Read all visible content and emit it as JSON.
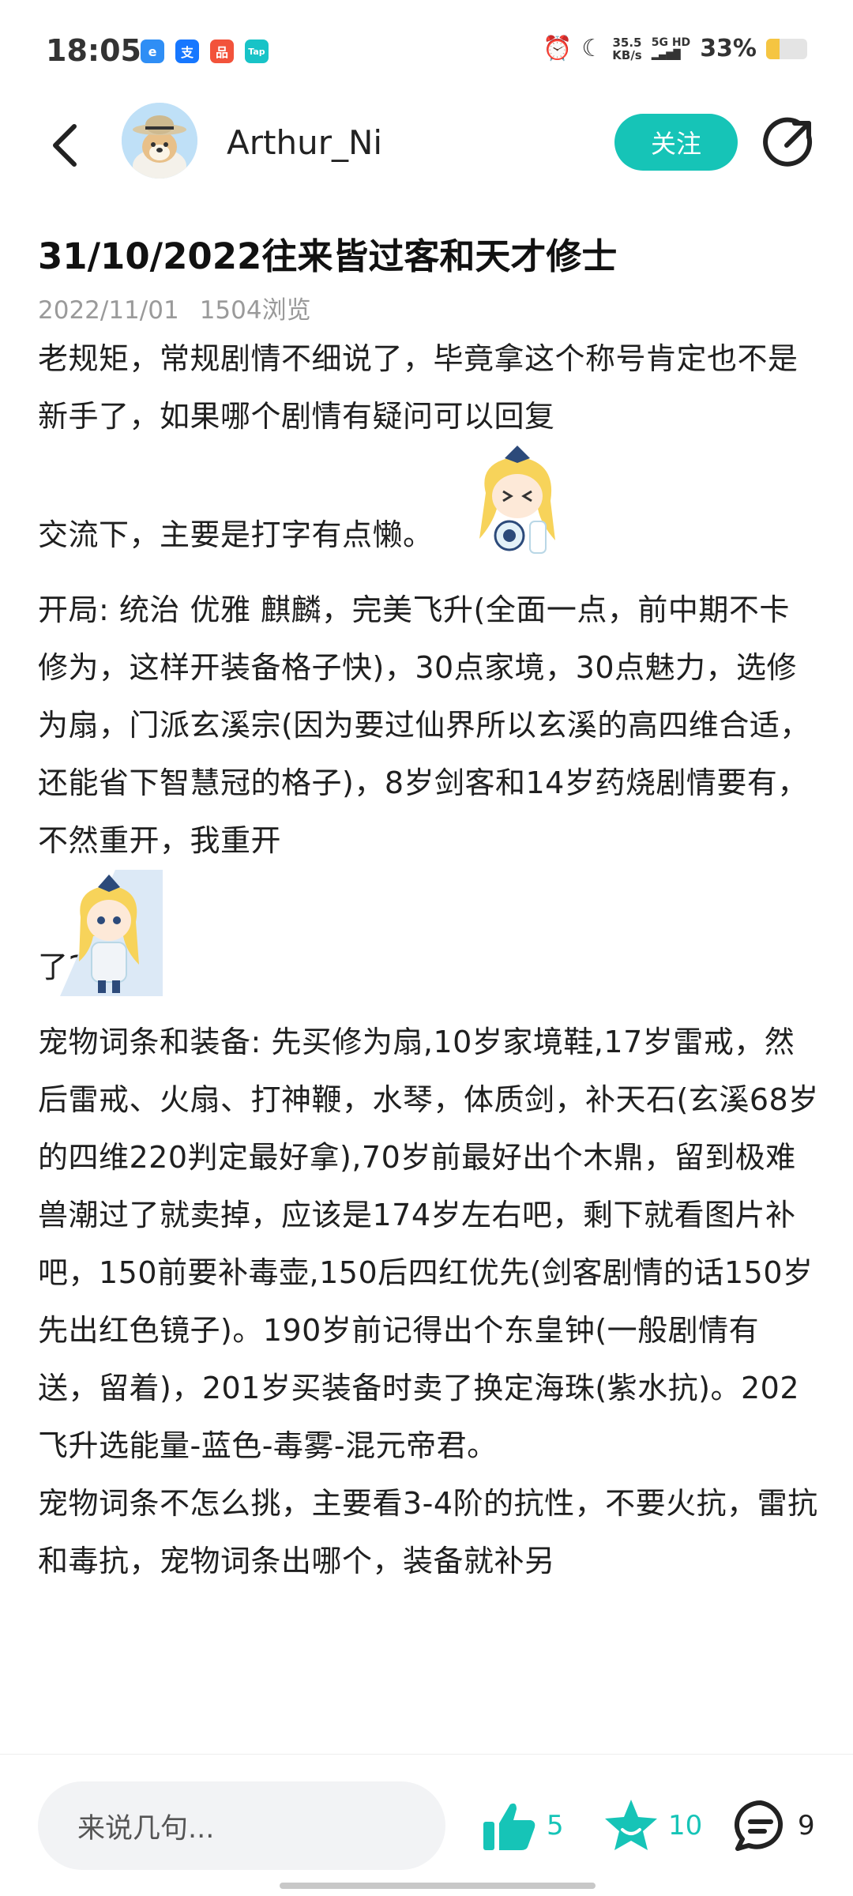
{
  "status_bar": {
    "time": "18:05",
    "apps": [
      {
        "label": "e",
        "color": "#2f8ef5",
        "icon": "app-icon-blue"
      },
      {
        "label": "支",
        "color": "#1677ff",
        "icon": "alipay-icon"
      },
      {
        "label": "品",
        "color": "#f2533b",
        "icon": "app-icon-red"
      },
      {
        "label": "Tap",
        "color": "#18c3c7",
        "icon": "taptap-icon"
      }
    ],
    "net_speed_value": "35.5",
    "net_speed_unit": "KB/s",
    "network_type": "5G HD",
    "battery_percent": "33%",
    "battery_level": 0.33,
    "battery_color": "#f5c542"
  },
  "header": {
    "username": "Arthur_Ni",
    "follow_label": "关注",
    "accent_color": "#16c4b7"
  },
  "post": {
    "title": "31/10/2022往来皆过客和天才修士",
    "date": "2022/11/01",
    "views": "1504浏览",
    "p1_main": "老规矩，常规剧情不细说了，毕竟拿这个称号肯定也不是新手了，如果哪个剧情有疑问可以回复",
    "p1_tail": "交流下，主要是打字有点懒。",
    "p2_main": "开局: 统治 优雅 麒麟，完美飞升(全面一点，前中期不卡修为，这样开装备格子快)，30点家境，30点魅力，选修为扇，门派玄溪宗(因为要过仙界所以玄溪的高四维合适，还能省下智慧冠的格子)，8岁剑客和14岁药烧剧情要有，不然重开，我重开",
    "p2_tail": "了2次。",
    "p3": "宠物词条和装备: 先买修为扇,10岁家境鞋,17岁雷戒，然后雷戒、火扇、打神鞭，水琴，体质剑，补天石(玄溪68岁的四维220判定最好拿),70岁前最好出个木鼎，留到极难兽潮过了就卖掉，应该是174岁左右吧，剩下就看图片补吧，150前要补毒壶,150后四红优先(剑客剧情的话150岁先出红色镜子)。190岁前记得出个东皇钟(一般剧情有送，留着)，201岁买装备时卖了换定海珠(紫水抗)。202飞升选能量-蓝色-毒雾-混元帝君。",
    "p4": "宠物词条不怎么挑，主要看3-4阶的抗性，不要火抗，雷抗和毒抗，宠物词条出哪个，装备就补另"
  },
  "bottom_bar": {
    "comment_placeholder": "来说几句...",
    "likes": "5",
    "favorites": "10",
    "comments": "9"
  }
}
